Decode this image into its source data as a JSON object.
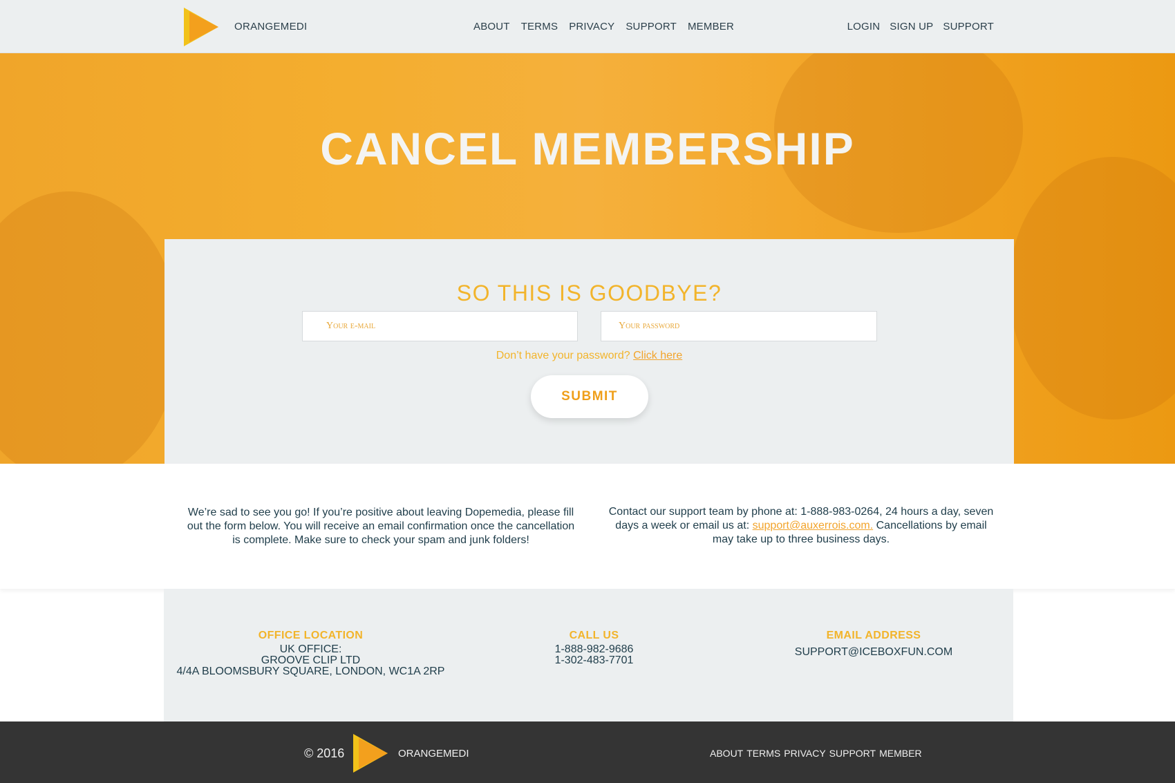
{
  "brand": {
    "name": "ORANGEMEDI",
    "logo_icon": "play-triangle-logo",
    "colors": {
      "primary": "#f2b42b",
      "accent": "#ee9a14"
    }
  },
  "header": {
    "nav_center": [
      "ABOUT",
      "TERMS",
      "PRIVACY",
      "SUPPORT",
      "MEMBER"
    ],
    "nav_right": [
      "LOGIN",
      "SIGN UP",
      "SUPPORT"
    ]
  },
  "hero": {
    "title": "CANCEL MEMBERSHIP"
  },
  "form": {
    "title": "SO THIS IS GOODBYE?",
    "email_placeholder": "Your e-mail",
    "password_placeholder": "Your password",
    "forgot_text": "Don’t have your password?",
    "forgot_link": "Click here",
    "submit_label": "SUBMIT"
  },
  "info": {
    "left_text": "We’re sad to see you go! If you’re positive about leaving Dopemedia, please fill out the form below. You will receive an email confirmation once the cancellation is complete. Make sure to check your spam and junk folders!",
    "right_text_1": "Contact our support team by phone at: 1-888-983-0264, 24 hours a day, seven days a week or email us at:",
    "right_link": "support@auxerrois.com.",
    "right_text_2": "Cancellations by email may take up to three business days."
  },
  "contact": {
    "office": {
      "title": "OFFICE LOCATION",
      "lines": [
        "UK OFFICE:",
        "GROOVE CLIP LTD",
        "4/4A BLOOMSBURY SQUARE, LONDON, WC1A 2RP"
      ]
    },
    "call": {
      "title": "CALL US",
      "lines": [
        "1-888-982-9686",
        "1-302-483-7701"
      ]
    },
    "email": {
      "title": "EMAIL ADDRESS",
      "value": "SUPPORT@ICEBOXFUN.COM"
    }
  },
  "footer": {
    "copyright": "© 2016",
    "brand": "ORANGEMEDI",
    "nav": [
      "ABOUT",
      "TERMS",
      "PRIVACY",
      "SUPPORT",
      "MEMBER"
    ]
  }
}
